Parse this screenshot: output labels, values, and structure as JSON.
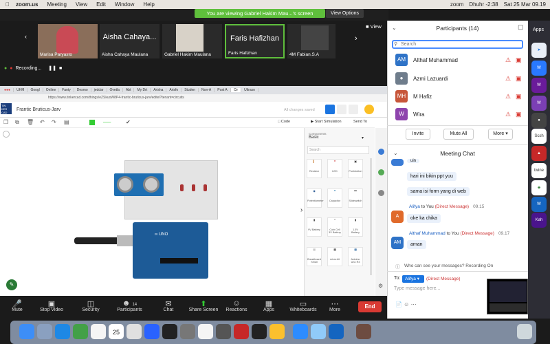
{
  "menubar": {
    "app": "zoom.us",
    "items": [
      "Meeting",
      "View",
      "Edit",
      "Window",
      "Help"
    ],
    "right_items": [
      "zoom",
      "Dhuhr -2:38",
      "Sat 25 Mar 09.19"
    ]
  },
  "zoom": {
    "banner": "You are viewing Gabriel Hakim Mau...'s screen",
    "view_options": "View Options",
    "view_label": "View",
    "recording": "Recording...",
    "tiles": [
      {
        "name": "Marisa Paryasto"
      },
      {
        "name": "Aisha Cahaya Maulana",
        "big": "Aisha Cahaya..."
      },
      {
        "name": "Gabriel Hakim Maulana"
      },
      {
        "name": "Faris Hafizhan",
        "big": "Faris Hafizhan"
      },
      {
        "name": "4M Fabian.S.A"
      }
    ]
  },
  "browser": {
    "tabs": [
      "UHM",
      "Googl",
      "Online",
      "Fanty",
      "Desmo",
      "jeddar",
      "Ovetla",
      "Abt",
      "My Drt",
      "Arisha",
      "Arisfo",
      "Studen",
      "Non-A",
      "Post A",
      "Cir",
      "Ultraso"
    ],
    "url": "https://www.tinkercad.com/things/eZSkuoW8P4-frantic-bruticus-jarv/editel?tenant=circuits"
  },
  "tinkercad": {
    "title": "Frantic Bruticus-Jarv",
    "saved": "All changes saved",
    "code_label": "Code",
    "start_sim": "Start Simulation",
    "send_to": "Send To",
    "components_label": "Components",
    "components_value": "Basic",
    "search_placeholder": "Search",
    "components": [
      "Resistor",
      "LED",
      "Pushbutton",
      "Potentiometer",
      "Capacitor",
      "Slideswitch",
      "9V Battery",
      "Coin Cell 3V Battery",
      "1.5V Battery",
      "Breadboard Small",
      "micro:bit",
      "Arduino Uno R3"
    ]
  },
  "controls": [
    {
      "label": "Mute",
      "icon": "microphone-icon"
    },
    {
      "label": "Stop Video",
      "icon": "video-icon"
    },
    {
      "label": "Security",
      "icon": "shield-icon"
    },
    {
      "label": "Participants",
      "icon": "people-icon",
      "count": "14"
    },
    {
      "label": "Chat",
      "icon": "chat-icon"
    },
    {
      "label": "Share Screen",
      "icon": "share-icon"
    },
    {
      "label": "Reactions",
      "icon": "reactions-icon"
    },
    {
      "label": "Apps",
      "icon": "apps-icon"
    },
    {
      "label": "Whiteboards",
      "icon": "whiteboard-icon"
    },
    {
      "label": "More",
      "icon": "more-icon"
    }
  ],
  "end_label": "End",
  "participants_panel": {
    "title": "Participants (14)",
    "search_placeholder": "Search",
    "list": [
      {
        "name": "Althaf Muhammad",
        "initials": "AM",
        "color": "#2f73c7"
      },
      {
        "name": "Azmi Lazuardi",
        "initials": "",
        "color": "#6f7d8c"
      },
      {
        "name": "M Hafiz",
        "initials": "MH",
        "color": "#c7563a"
      },
      {
        "name": "Wira",
        "initials": "W",
        "color": "#8e44ad"
      }
    ],
    "invite": "Invite",
    "mute_all": "Mute All",
    "more": "More"
  },
  "chat": {
    "title": "Meeting Chat",
    "partial": "uin",
    "messages_me": [
      "hari ini bikin ppt yuu",
      "sama isi form yang di web"
    ],
    "msg1": {
      "from": "Alifya",
      "to": "to You",
      "dm": "(Direct Message)",
      "time": "09.15",
      "text": "oke ka chika",
      "initial": "A"
    },
    "msg2": {
      "from": "Althaf Muhammad",
      "to": "to You",
      "dm": "(Direct Message)",
      "time": "09.17",
      "text": "aman",
      "initial": "AM"
    },
    "who_can_see": "Who can see your messages? Recording On",
    "to_label": "To:",
    "to_value": "Alifya",
    "to_dm": "(Direct Message)",
    "placeholder": "Type message here..."
  },
  "apps_label": "Apps"
}
